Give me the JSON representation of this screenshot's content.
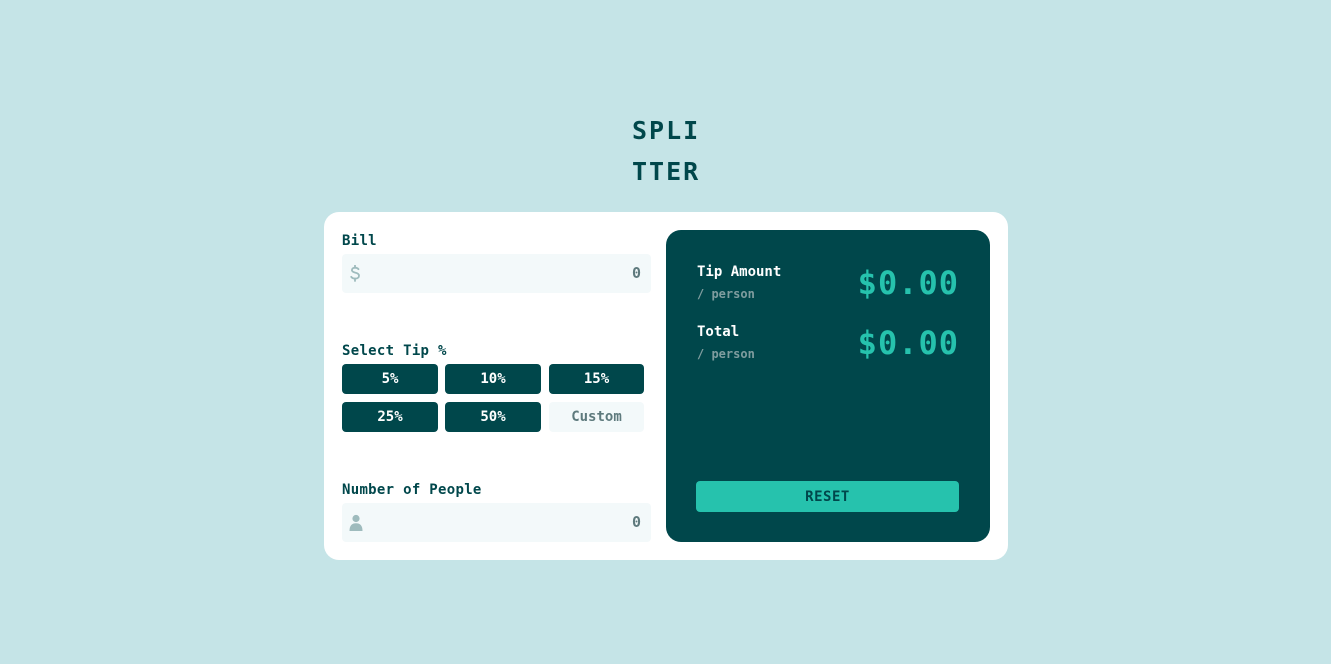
{
  "logo": {
    "line1": "SPLI",
    "line2": "TTER"
  },
  "bill": {
    "label": "Bill",
    "value": "0",
    "icon": "dollar-icon"
  },
  "tip": {
    "label": "Select Tip %",
    "options": [
      "5%",
      "10%",
      "15%",
      "25%",
      "50%"
    ],
    "custom_placeholder": "Custom"
  },
  "people": {
    "label": "Number of People",
    "value": "0",
    "icon": "person-icon"
  },
  "results": {
    "tip_label": "Tip Amount",
    "tip_sub": "/ person",
    "tip_value": "$0.00",
    "total_label": "Total",
    "total_sub": "/ person",
    "total_value": "$0.00",
    "reset_label": "RESET"
  },
  "colors": {
    "background": "#c5e4e7",
    "dark_cyan": "#00474b",
    "accent_cyan": "#26c2ad",
    "input_bg": "#f3f9fa",
    "muted_text": "#5e7a7d"
  }
}
